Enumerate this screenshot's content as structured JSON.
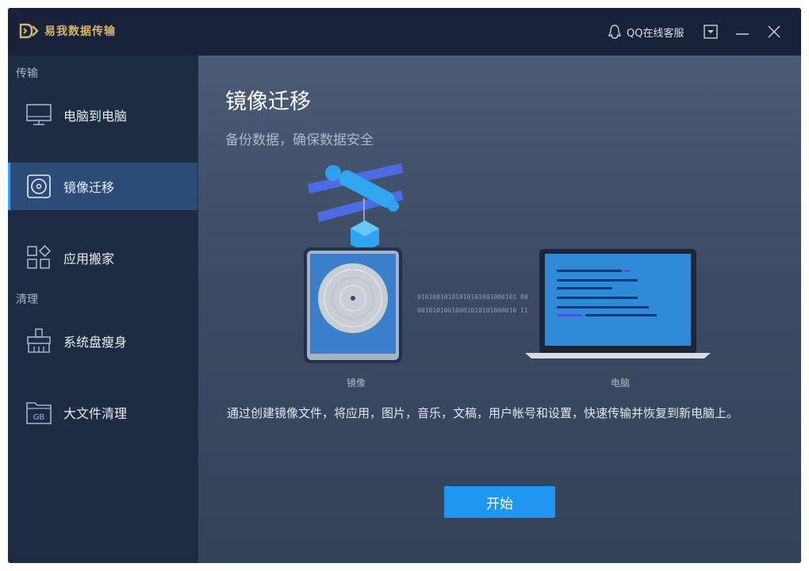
{
  "titlebar": {
    "app_title": "易我数据传输",
    "support_label": "QQ在线客服"
  },
  "sidebar": {
    "sections": [
      {
        "label": "传输"
      },
      {
        "label": "清理"
      }
    ],
    "items": [
      {
        "label": "电脑到电脑",
        "icon": "monitor-icon",
        "active": false
      },
      {
        "label": "镜像迁移",
        "icon": "disc-icon",
        "active": true
      },
      {
        "label": "应用搬家",
        "icon": "apps-icon",
        "active": false
      },
      {
        "label": "系统盘瘦身",
        "icon": "broom-icon",
        "active": false
      },
      {
        "label": "大文件清理",
        "icon": "gb-folder-icon",
        "active": false
      }
    ]
  },
  "main": {
    "title": "镜像迁移",
    "subtitle": "备份数据，确保数据安全",
    "binary_line_1": "01010010101010101001000101 00",
    "binary_line_2": "00101010010001010101000010 11",
    "caption_image": "镜像",
    "caption_pc": "电脑",
    "description": "通过创建镜像文件，将应用，图片，音乐，文稿，用户帐号和设置，快速传输并恢复到新电脑上。",
    "start_label": "开始"
  },
  "colors": {
    "accent": "#1f96f2",
    "sidebar_bg": "#1d2b43",
    "active_item": "#2b4c77",
    "brand_gold": "#d7b46a"
  }
}
